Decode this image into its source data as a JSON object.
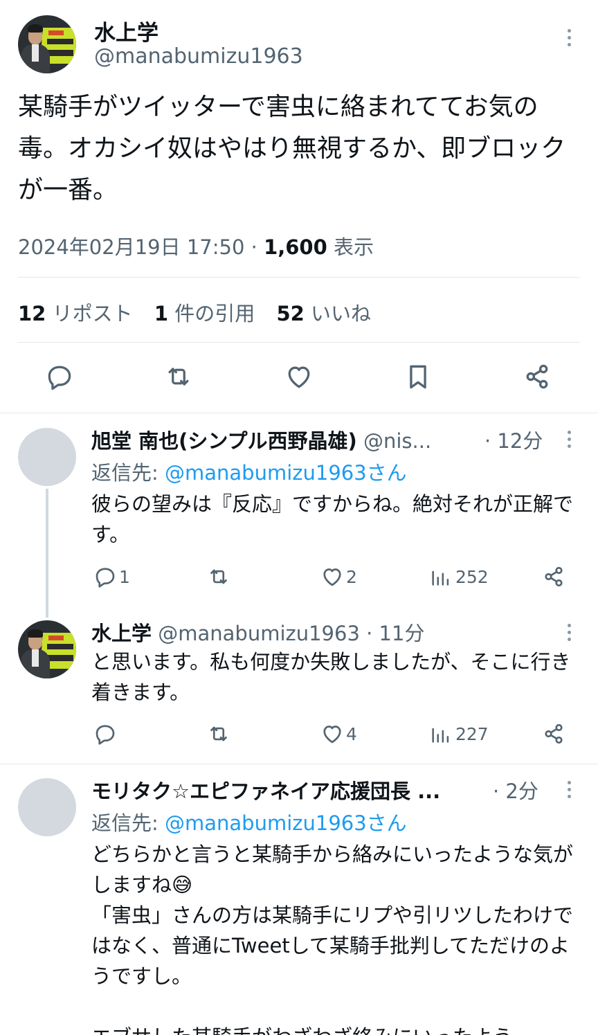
{
  "main_tweet": {
    "author_name": "水上学",
    "handle": "@manabumizu1963",
    "text": "某騎手がツイッターで害虫に絡まれててお気の毒。オカシイ奴はやはり無視するか、即ブロックが一番。",
    "timestamp": "2024年02月19日 17:50",
    "separator": "·",
    "views_count": "1,600",
    "views_label": "表示",
    "reposts_count": "12",
    "reposts_label": "リポスト",
    "quotes_count": "1",
    "quotes_label": "件の引用",
    "likes_count": "52",
    "likes_label": "いいね"
  },
  "replies": [
    {
      "author_name": "旭堂 南也(シンプル西野晶雄)",
      "handle": "@nis...",
      "time": "· 12分",
      "reply_to_label": "返信先: ",
      "reply_to_handle": "@manabumizu1963さん",
      "text": "彼らの望みは『反応』ですからね。絶対それが正解です。",
      "reply_count": "1",
      "repost_count": "",
      "like_count": "2",
      "view_count": "252"
    },
    {
      "author_name": "水上学",
      "handle": "@manabumizu1963",
      "time": "· 11分",
      "text": "と思います。私も何度か失敗しましたが、そこに行き着きます。",
      "reply_count": "",
      "repost_count": "",
      "like_count": "4",
      "view_count": "227"
    },
    {
      "author_name": "モリタク☆エピファネイア応援団長 ...",
      "handle": "",
      "time": "· 2分",
      "reply_to_label": "返信先: ",
      "reply_to_handle": "@manabumizu1963さん",
      "text_line1": "どちらかと言うと某騎手から絡みにいったような気がしますね😅",
      "text_line2": "「害虫」さんの方は某騎手にリプや引リツしたわけではなく、普通にTweetして某騎手批判してただけのようですし。",
      "text_line3": "エブサした某騎手がわざわざ絡みにいったよう"
    }
  ],
  "icons": {
    "reply": "comment-bubble-icon",
    "repost": "repost-arrows-icon",
    "like": "heart-icon",
    "bookmark": "bookmark-icon",
    "share": "share-icon",
    "views": "bar-chart-icon",
    "more": "more-vertical-icon"
  },
  "colors": {
    "text": "#0f1419",
    "muted": "#536471",
    "link": "#1d9bf0",
    "divider": "#e4e8eb"
  }
}
